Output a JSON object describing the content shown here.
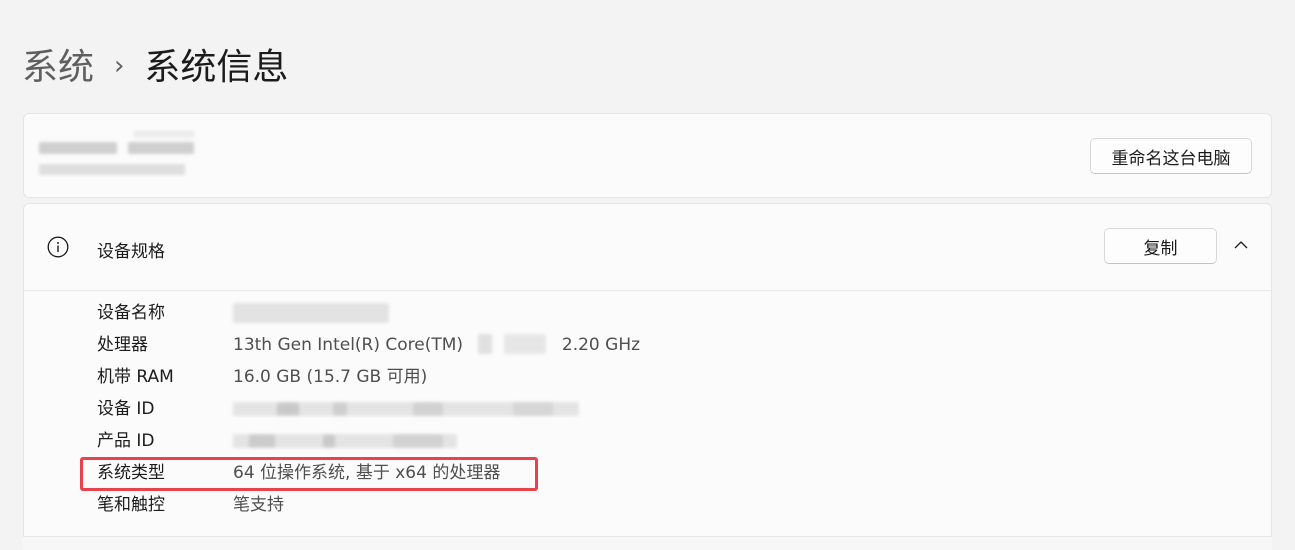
{
  "breadcrumb": {
    "parent": "系统",
    "separator": "›",
    "current": "系统信息"
  },
  "pc_card": {
    "rename_button": "重命名这台电脑"
  },
  "spec_card": {
    "title": "设备规格",
    "copy_button": "复制",
    "icon": "info-icon",
    "collapse_icon": "chevron-up-icon",
    "rows": [
      {
        "key": "设备名称",
        "value": ""
      },
      {
        "key": "处理器",
        "value": "13th Gen Intel(R) Core(TM)",
        "value_suffix": "2.20 GHz"
      },
      {
        "key": "机带 RAM",
        "value": "16.0 GB (15.7 GB 可用)"
      },
      {
        "key": "设备 ID",
        "value": ""
      },
      {
        "key": "产品 ID",
        "value": ""
      },
      {
        "key": "系统类型",
        "value": "64 位操作系统, 基于 x64 的处理器"
      },
      {
        "key": "笔和触控",
        "value": "笔支持"
      }
    ]
  },
  "colors": {
    "highlight": "#e8424d",
    "background": "#f3f3f3",
    "card": "#fbfbfb"
  }
}
